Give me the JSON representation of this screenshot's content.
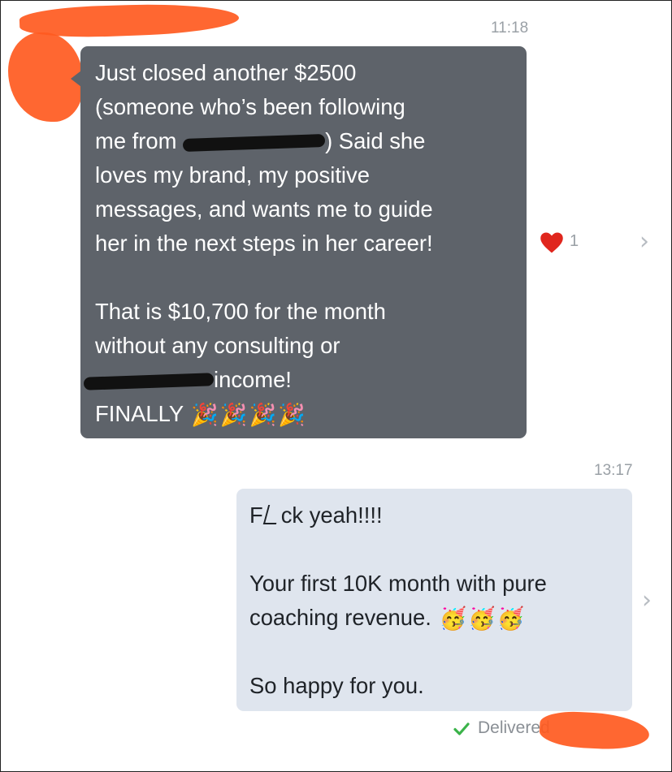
{
  "conversation": {
    "incoming": {
      "time": "11:18",
      "lines": [
        "Just closed another $2500",
        "(someone who’s been following",
        "me from",
        ") Said she",
        "loves my brand, my positive",
        "messages, and wants me to guide",
        "her in the next steps in her career!",
        "That is $10,700 for the month",
        "without any consulting or",
        "income!",
        "FINALLY"
      ],
      "emoji": "🎉",
      "reaction": {
        "icon": "heart-icon",
        "count": "1",
        "color": "#e0261d"
      }
    },
    "outgoing": {
      "time": "13:17",
      "lines": [
        "F",
        "ck yeah!!!!",
        "Your first 10K month with pure",
        "coaching revenue.",
        "So happy for you."
      ],
      "emoji": "🥳",
      "status": "Delivered"
    }
  },
  "colors": {
    "incoming_bubble": "#5e636a",
    "outgoing_bubble": "#dfe5ee",
    "delivered_check": "#3bb34a",
    "redaction_marker": "#ff5a1f"
  }
}
